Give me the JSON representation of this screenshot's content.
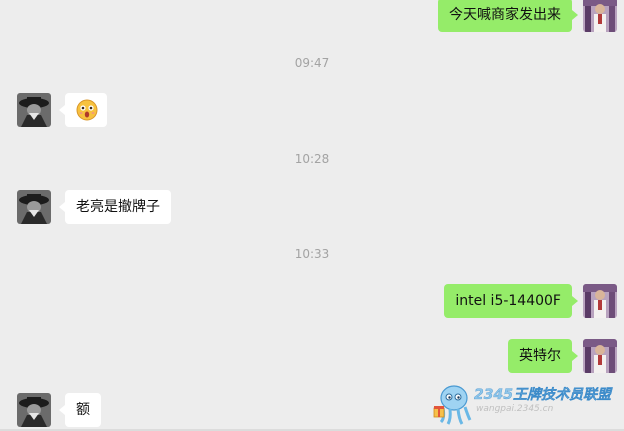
{
  "messages": [
    {
      "side": "right",
      "kind": "text",
      "text": "今天喊商家发出来"
    },
    {
      "kind": "time",
      "text": "09:47"
    },
    {
      "side": "left",
      "kind": "emoji",
      "emoji": "surprised-face"
    },
    {
      "kind": "time",
      "text": "10:28"
    },
    {
      "side": "left",
      "kind": "text",
      "text": "老亮是撤牌子"
    },
    {
      "kind": "time",
      "text": "10:33"
    },
    {
      "side": "right",
      "kind": "text",
      "text": "intel i5-14400F"
    },
    {
      "side": "right",
      "kind": "text",
      "text": "英特尔"
    },
    {
      "side": "left",
      "kind": "text",
      "text": "额"
    }
  ],
  "watermark": {
    "title": "2345王牌技术员联盟",
    "url": "wangpai.2345.cn"
  },
  "colors": {
    "background": "#ededed",
    "incoming_bubble": "#ffffff",
    "outgoing_bubble": "#95ec69",
    "timestamp": "#a3a3a3"
  }
}
